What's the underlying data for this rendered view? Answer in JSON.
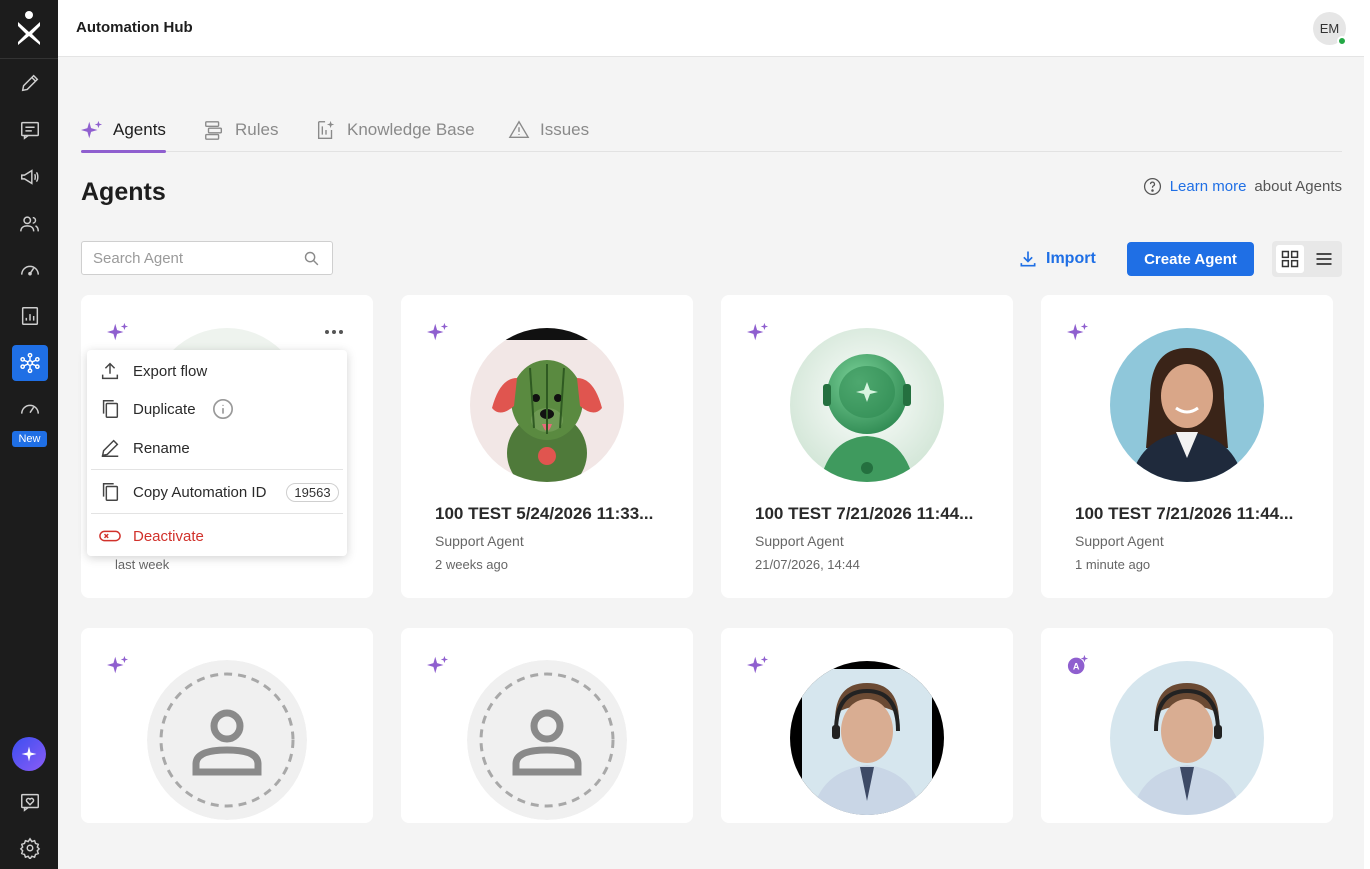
{
  "app": {
    "title": "Automation Hub",
    "user_initials": "EM"
  },
  "rail": {
    "new_badge": "New"
  },
  "tabs": [
    {
      "label": "Agents"
    },
    {
      "label": "Rules"
    },
    {
      "label": "Knowledge Base"
    },
    {
      "label": "Issues"
    }
  ],
  "page": {
    "title": "Agents",
    "learn_link": "Learn more",
    "learn_suffix": "about Agents"
  },
  "search": {
    "placeholder": "Search Agent"
  },
  "toolbar": {
    "import_label": "Import",
    "create_label": "Create Agent"
  },
  "menu": {
    "export": "Export flow",
    "duplicate": "Duplicate",
    "rename": "Rename",
    "copy_id": "Copy Automation ID",
    "automation_id": "19563",
    "deactivate": "Deactivate"
  },
  "cards": [
    {
      "name": "",
      "type": "",
      "time": "last week",
      "icon": "sparkle-icon"
    },
    {
      "name": "100 TEST 5/24/2026 11:33...",
      "type": "Support Agent",
      "time": "2 weeks ago",
      "icon": "sparkle-icon",
      "image": "watermelon-dog-avatar"
    },
    {
      "name": "100 TEST 7/21/2026 11:44...",
      "type": "Support Agent",
      "time": "21/07/2026, 14:44",
      "icon": "sparkle-icon",
      "image": "green-robot-avatar"
    },
    {
      "name": "100 TEST 7/21/2026 11:44...",
      "type": "Support Agent",
      "time": "1 minute ago",
      "icon": "sparkle-icon",
      "image": "woman-portrait-avatar"
    },
    {
      "icon": "sparkle-icon",
      "image": "placeholder-person-avatar"
    },
    {
      "icon": "sparkle-icon",
      "image": "placeholder-person-avatar"
    },
    {
      "icon": "sparkle-icon",
      "image": "headset-man-avatar"
    },
    {
      "icon": "ai-agent-badge-icon",
      "image": "headset-man-avatar"
    }
  ],
  "colors": {
    "accent": "#1f6fe5",
    "tab_underline": "#8f5fcf",
    "danger": "#d1312b",
    "rail": "#1c1c1c"
  }
}
